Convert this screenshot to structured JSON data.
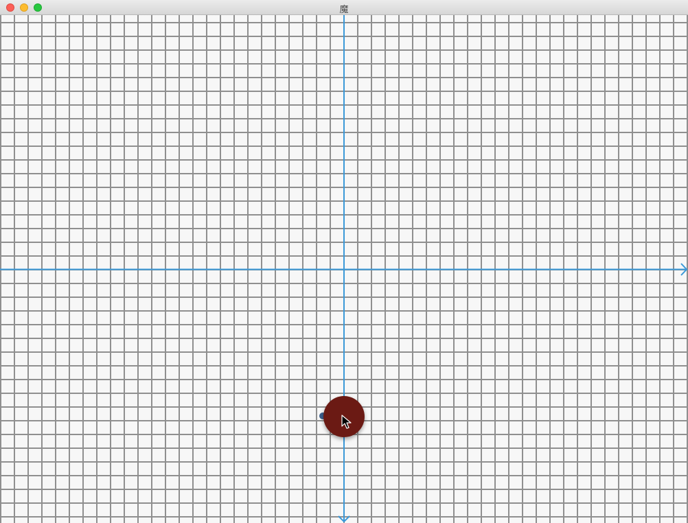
{
  "window": {
    "title": "魔"
  },
  "titlebar": {
    "buttons": [
      {
        "name": "close",
        "color": "#fc5f57"
      },
      {
        "name": "minimize",
        "color": "#fdbc2e"
      },
      {
        "name": "zoom",
        "color": "#28c840"
      }
    ]
  },
  "canvas": {
    "grid_color": "#8f8f8f",
    "background_color": "#f7f7f7",
    "axis_color": "#3a98d8",
    "x_axis_direction": "right",
    "y_axis_direction": "down"
  },
  "ball": {
    "color": "#6b1a14",
    "anchor_color": "#3c5f8c"
  },
  "cursor": {
    "icon": "arrow-cursor-icon"
  }
}
